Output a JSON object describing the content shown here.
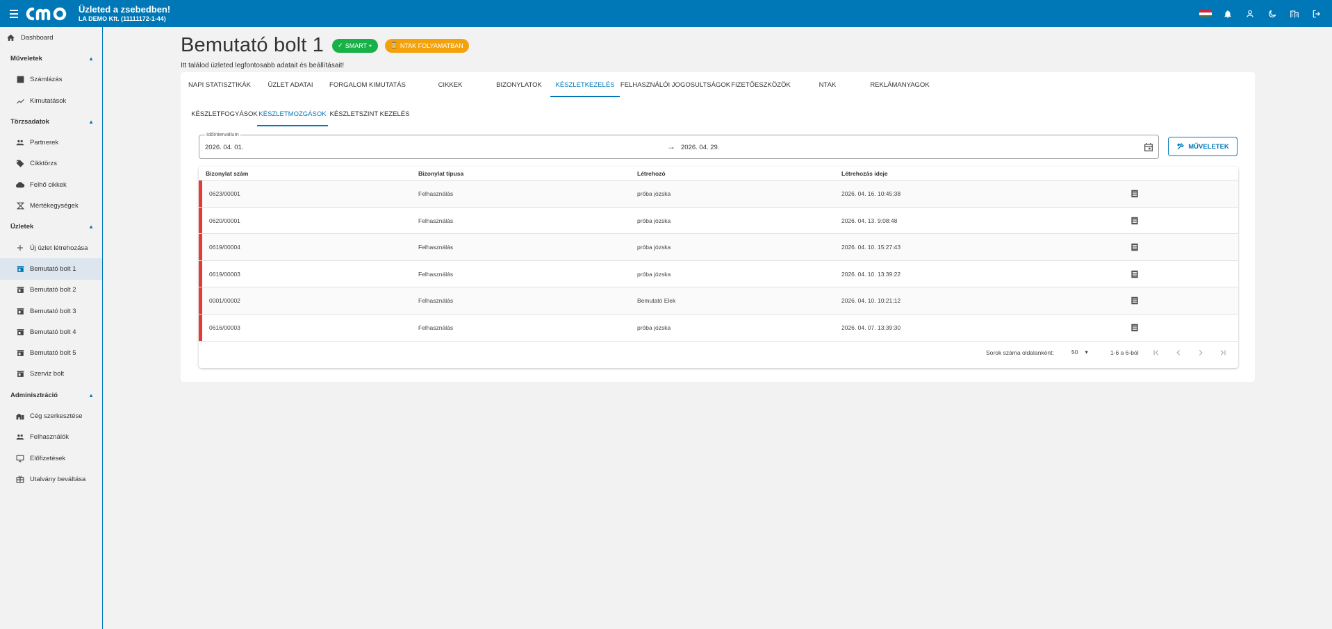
{
  "header": {
    "title": "Üzleted a zsebedben!",
    "company": "LA DEMO Kft. (11111172-1-44)",
    "colors": {
      "primary": "#0078b8"
    },
    "icons": [
      "menu-icon",
      "hu-flag-icon",
      "bell-icon",
      "user-icon",
      "dark-mode-icon",
      "company-icon",
      "logout-icon"
    ]
  },
  "sidebar": {
    "dashboard": "Dashboard",
    "groups": [
      {
        "label": "Műveletek",
        "items": [
          "Számlázás",
          "Kimutatások"
        ]
      },
      {
        "label": "Törzsadatok",
        "items": [
          "Partnerek",
          "Cikktörzs",
          "Felhő cikkek",
          "Mértékegységek"
        ]
      },
      {
        "label": "Üzletek",
        "items": [
          "Új üzlet létrehozása",
          "Bemutató bolt 1",
          "Bemutató bolt 2",
          "Bemutató bolt 3",
          "Bemutató bolt 4",
          "Bemutató bolt 5",
          "Szerviz bolt"
        ]
      },
      {
        "label": "Adminisztráció",
        "items": [
          "Cég szerkesztése",
          "Felhasználók",
          "Előfizetések",
          "Utalvány beváltása"
        ]
      }
    ]
  },
  "page": {
    "title": "Bemutató bolt 1",
    "badge_smart": "SMART +",
    "badge_ntak": "NTAK FOLYAMATBAN",
    "subtitle": "Itt találod üzleted legfontosabb adatait és beállításait!"
  },
  "tabs": [
    "NAPI STATISZTIKÁK",
    "ÜZLET ADATAI",
    "FORGALOM KIMUTATÁS",
    "CIKKEK",
    "BIZONYLATOK",
    "KÉSZLETKEZELÉS",
    "FELHASZNÁLÓI JOGOSULTSÁGOK",
    "FIZETŐESZKÖZÖK",
    "NTAK",
    "REKLÁMANYAGOK"
  ],
  "subtabs": [
    "KÉSZLETFOGYÁSOK",
    "KÉSZLETMOZGÁSOK",
    "KÉSZLETSZINT KEZELÉS"
  ],
  "filter": {
    "legend": "Időintervallum",
    "from": "2026. 04. 01.",
    "arrow": "→",
    "to": "2026. 04. 29.",
    "ops_button": "MŰVELETEK"
  },
  "table": {
    "headers": [
      "Bizonylat szám",
      "Bizonylat típusa",
      "Létrehozó",
      "Létrehozás ideje"
    ],
    "rows": [
      [
        "0623/00001",
        "Felhasználás",
        "próba józska",
        "2026. 04. 16. 10:45:38"
      ],
      [
        "0620/00001",
        "Felhasználás",
        "próba józska",
        "2026. 04. 13. 9:08:48"
      ],
      [
        "0619/00004",
        "Felhasználás",
        "próba józska",
        "2026. 04. 10. 15:27:43"
      ],
      [
        "0619/00003",
        "Felhasználás",
        "próba józska",
        "2026. 04. 10. 13:39:22"
      ],
      [
        "0001/00002",
        "Felhasználás",
        "Bemutató Elek",
        "2026. 04. 10. 10:21:12"
      ],
      [
        "0616/00003",
        "Felhasználás",
        "próba józska",
        "2026. 04. 07. 13:39:30"
      ]
    ],
    "status_color": "#e53935"
  },
  "pagination": {
    "rows_per_page_label": "Sorok száma oldalanként:",
    "rows_per_page": "50",
    "range": "1-6 a 6-ból"
  }
}
